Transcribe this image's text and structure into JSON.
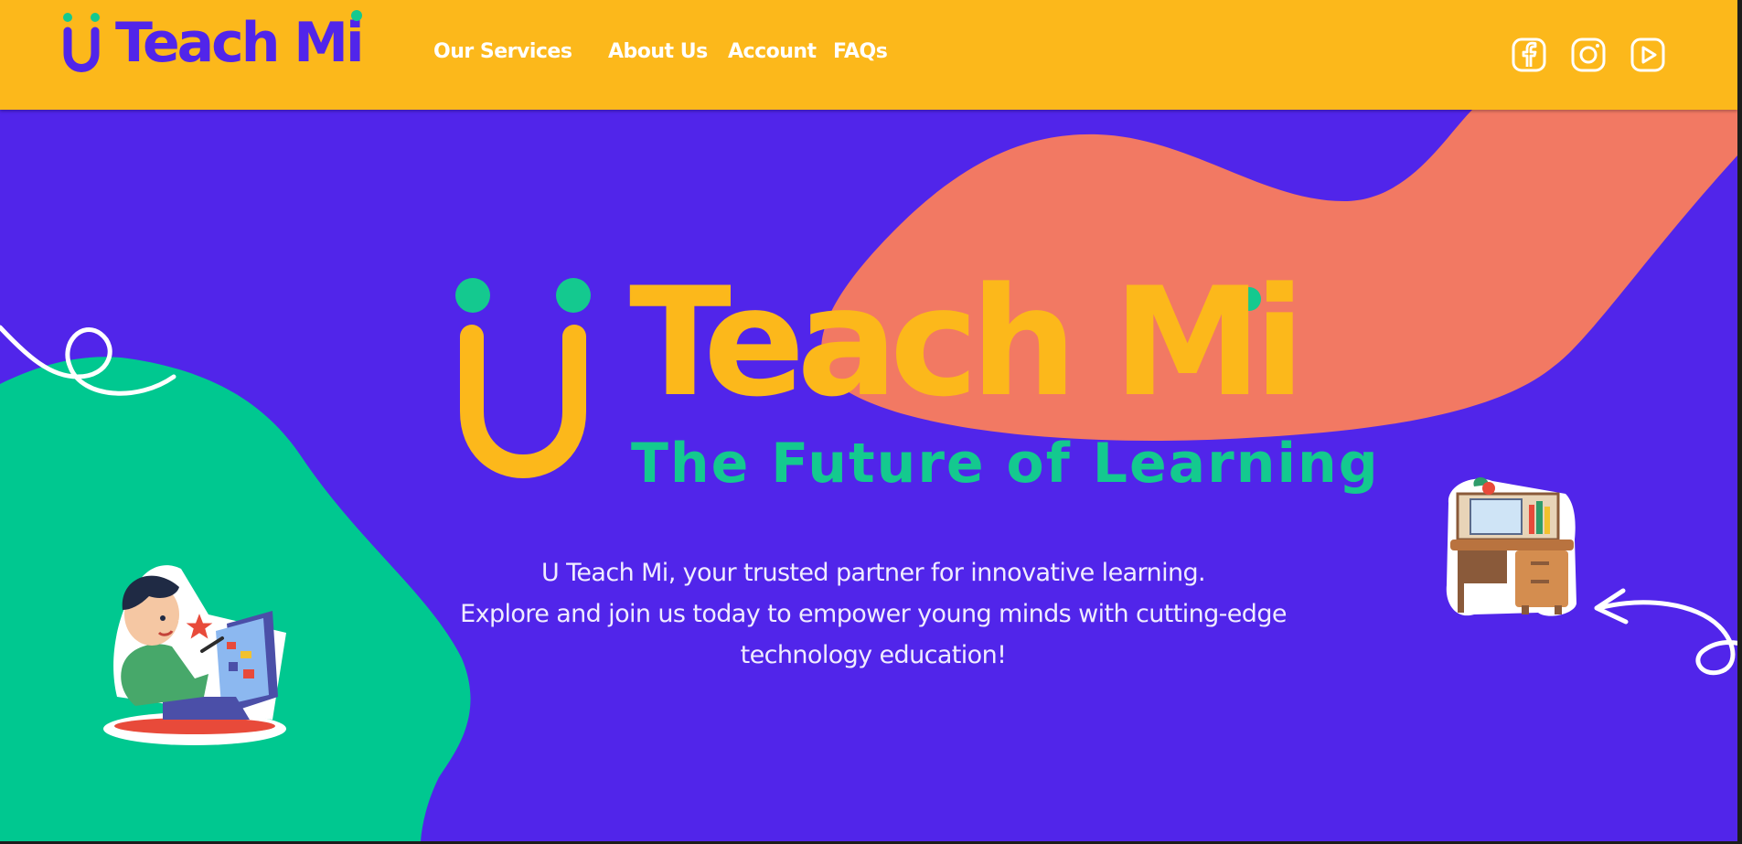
{
  "colors": {
    "brand_purple": "#5125ea",
    "brand_yellow": "#fcb81b",
    "brand_green": "#14c98f",
    "coral": "#f27963",
    "white": "#ffffff"
  },
  "header": {
    "brand": "U Teach Mi",
    "nav": [
      {
        "label": "Our Services"
      },
      {
        "label": "About Us"
      },
      {
        "label": "Account"
      },
      {
        "label": "FAQs"
      }
    ],
    "social_icons": [
      "facebook-icon",
      "instagram-icon",
      "youtube-icon"
    ]
  },
  "hero": {
    "brand": "Teach Mi",
    "brand_full": "U Teach Mi",
    "tagline": "The Future of Learning",
    "description": [
      "U Teach Mi, your trusted partner for innovative learning.",
      "Explore and join us today to empower young minds with cutting-edge",
      "technology education!"
    ],
    "illustrations": [
      "boy-at-computer-illustration",
      "study-desk-illustration"
    ]
  }
}
